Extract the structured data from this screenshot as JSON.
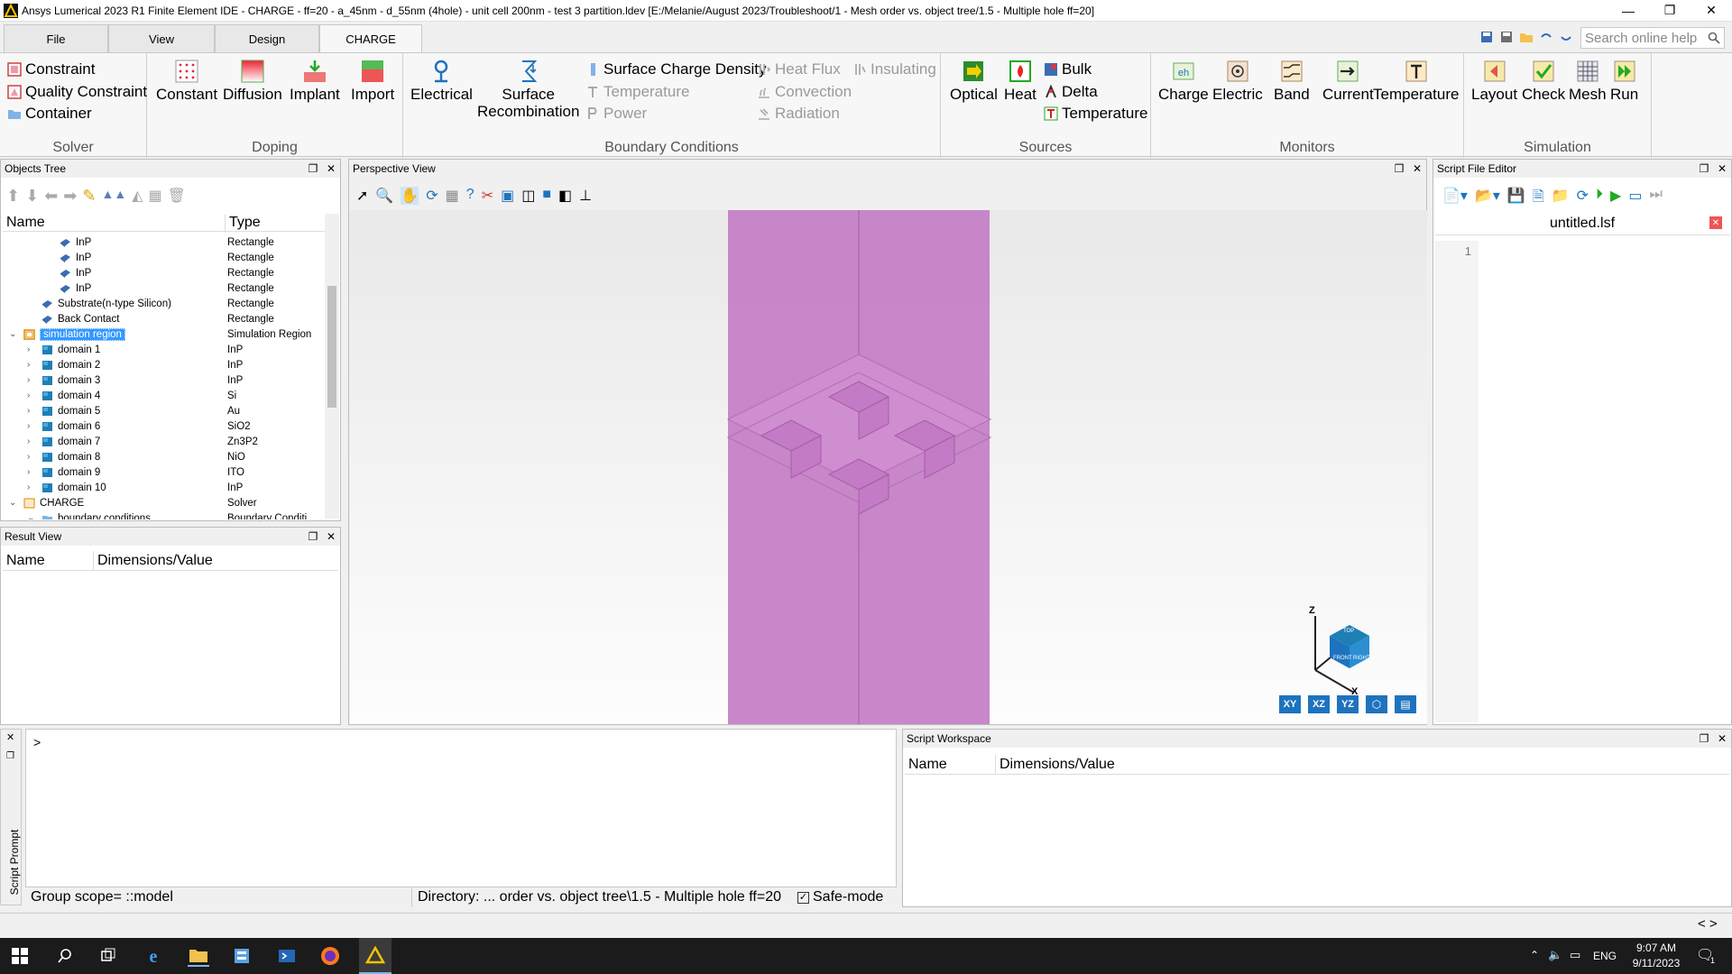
{
  "window": {
    "title": "Ansys Lumerical 2023 R1 Finite Element IDE - CHARGE - ff=20 - a_45nm - d_55nm (4hole) - unit cell 200nm - test 3 partition.ldev [E:/Melanie/August 2023/Troubleshoot/1 - Mesh order vs. object tree/1.5 - Multiple hole ff=20]",
    "minimize": "—",
    "maximize": "❐",
    "close": "✕"
  },
  "tabs": [
    "File",
    "View",
    "Design",
    "CHARGE"
  ],
  "search": {
    "placeholder": "Search online help"
  },
  "ribbon": {
    "solver": {
      "label": "Solver",
      "items": [
        "Constraint",
        "Quality Constraint",
        "Container"
      ]
    },
    "doping": {
      "label": "Doping",
      "items": [
        "Constant",
        "Diffusion",
        "Implant",
        "Import"
      ]
    },
    "boundary": {
      "label": "Boundary Conditions",
      "electrical": "Electrical",
      "surface_rec_1": "Surface",
      "surface_rec_2": "Recombination",
      "small": [
        "Surface Charge Density",
        "Temperature",
        "Power",
        "Heat Flux",
        "Convection",
        "Radiation",
        "Insulating"
      ]
    },
    "sources": {
      "label": "Sources",
      "big": [
        "Optical",
        "Heat"
      ],
      "small": [
        "Bulk",
        "Delta",
        "Temperature"
      ]
    },
    "monitors": {
      "label": "Monitors",
      "items": [
        "Charge",
        "Electric",
        "Band",
        "Current",
        "Temperature"
      ]
    },
    "simulation": {
      "label": "Simulation",
      "items": [
        "Layout",
        "Check",
        "Mesh",
        "Run"
      ]
    }
  },
  "objects_tree": {
    "title": "Objects Tree",
    "col_name": "Name",
    "col_type": "Type",
    "rows": [
      {
        "name": "InP",
        "type": "Rectangle"
      },
      {
        "name": "InP",
        "type": "Rectangle"
      },
      {
        "name": "InP",
        "type": "Rectangle"
      },
      {
        "name": "InP",
        "type": "Rectangle"
      },
      {
        "name": "Substrate(n-type Silicon)",
        "type": "Rectangle"
      },
      {
        "name": "Back Contact",
        "type": "Rectangle"
      },
      {
        "name": "simulation region",
        "type": "Simulation Region"
      },
      {
        "name": "domain 1",
        "type": "InP"
      },
      {
        "name": "domain 2",
        "type": "InP"
      },
      {
        "name": "domain 3",
        "type": "InP"
      },
      {
        "name": "domain 4",
        "type": "Si"
      },
      {
        "name": "domain 5",
        "type": "Au"
      },
      {
        "name": "domain 6",
        "type": "SiO2"
      },
      {
        "name": "domain 7",
        "type": "Zn3P2"
      },
      {
        "name": "domain 8",
        "type": "NiO"
      },
      {
        "name": "domain 9",
        "type": "ITO"
      },
      {
        "name": "domain 10",
        "type": "InP"
      },
      {
        "name": "CHARGE",
        "type": "Solver"
      },
      {
        "name": "boundary conditions",
        "type": "Boundary Conditi..."
      }
    ]
  },
  "result_view": {
    "title": "Result View",
    "col_name": "Name",
    "col_value": "Dimensions/Value"
  },
  "perspective_view": {
    "title": "Perspective View",
    "axis_z": "Z",
    "axis_x": "X",
    "cube_top": "TOP",
    "cube_front": "FRONT",
    "cube_right": "RIGHT",
    "views": [
      "XY",
      "XZ",
      "YZ"
    ]
  },
  "script_editor": {
    "title": "Script File Editor",
    "file_tab": "untitled.lsf",
    "line1": "1"
  },
  "script_prompt": {
    "side_label": "Script Prompt",
    "prompt": ">",
    "group_scope": "Group scope= ::model",
    "directory": "Directory: ... order vs. object tree\\1.5 - Multiple hole ff=20",
    "safe_mode": "Safe-mode"
  },
  "script_workspace": {
    "title": "Script Workspace",
    "col_name": "Name",
    "col_value": "Dimensions/Value"
  },
  "statusbar": {
    "nav": "< >"
  },
  "taskbar": {
    "lang": "ENG",
    "time": "9:07 AM",
    "date": "9/11/2023",
    "notif": "1"
  },
  "colors": {
    "accent": "#0078d7",
    "selection": "#3399ff",
    "model_pink": "#c27bc4",
    "taskbar": "#1b1b1b"
  }
}
